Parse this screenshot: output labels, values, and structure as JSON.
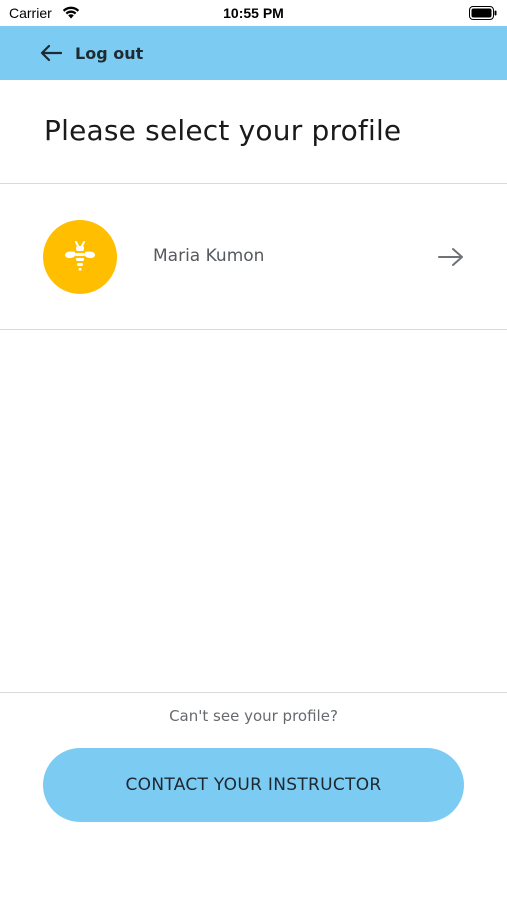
{
  "status_bar": {
    "carrier": "Carrier",
    "time": "10:55 PM",
    "icons": [
      "wifi-icon",
      "battery-icon"
    ]
  },
  "nav": {
    "back_icon": "arrow-left-icon",
    "logout_label": "Log out",
    "background_color": "#7ccbf2"
  },
  "page": {
    "title": "Please select your profile"
  },
  "profiles": [
    {
      "name": "Maria Kumon",
      "avatar_icon": "bee-icon",
      "avatar_color": "#ffbf00",
      "action_icon": "arrow-right-icon"
    }
  ],
  "footer": {
    "hint": "Can't see your profile?",
    "contact_button_label": "CONTACT YOUR INSTRUCTOR",
    "button_color": "#7ccbf2"
  }
}
